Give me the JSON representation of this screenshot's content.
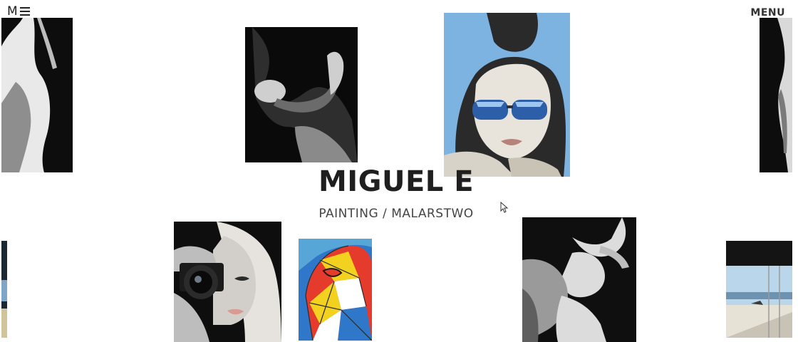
{
  "header": {
    "logo_text": "M",
    "menu_label": "MENU"
  },
  "hero": {
    "title": "MIGUEL E",
    "subtitle": "PAINTING / MALARSTWO"
  },
  "gallery": {
    "paintings": [
      {
        "subject": "nude-figure-torso",
        "colors": [
          "#0d0d0d",
          "#e9e9e9",
          "#8e8e8e"
        ]
      },
      {
        "subject": "embracing-couple",
        "colors": [
          "#0a0a0a",
          "#cfcfcf",
          "#6b6b6b"
        ]
      },
      {
        "subject": "woman-blue-sunglasses",
        "colors": [
          "#7db3e0",
          "#2a2a2a",
          "#2c5fa8",
          "#e8e4dc"
        ]
      },
      {
        "subject": "figure-edge-right",
        "colors": [
          "#0d0d0d",
          "#d9d9d9"
        ]
      },
      {
        "subject": "woman-with-camera",
        "colors": [
          "#0e0e0e",
          "#e6e3df",
          "#bdbdbd"
        ]
      },
      {
        "subject": "cubist-face",
        "colors": [
          "#e53b2c",
          "#f2d21f",
          "#2f77c9",
          "#2a2a2a"
        ]
      },
      {
        "subject": "reclining-nude",
        "colors": [
          "#0f0f0f",
          "#dcdcdc",
          "#9a9a9a"
        ]
      },
      {
        "subject": "modern-interior-sea",
        "colors": [
          "#0c0c0c",
          "#b9d6ea",
          "#e6e2d6"
        ]
      },
      {
        "subject": "beach-edge-left",
        "colors": [
          "#1b2733",
          "#d2c49a"
        ]
      }
    ]
  }
}
